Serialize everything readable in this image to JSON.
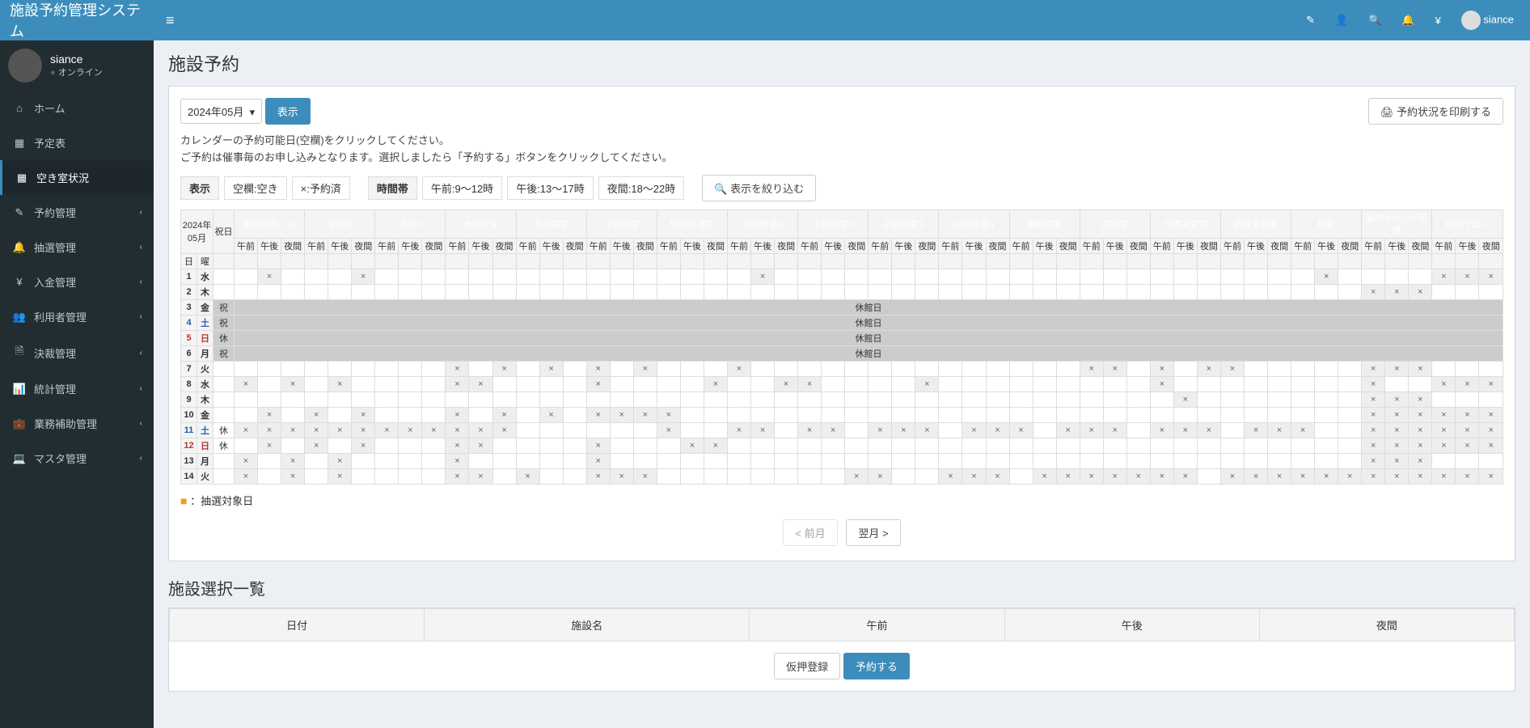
{
  "app_title": "施設予約管理システム",
  "user": {
    "name": "siance",
    "status": "オンライン"
  },
  "nav": [
    {
      "icon": "⌂",
      "label": "ホーム",
      "arrow": false,
      "active": false
    },
    {
      "icon": "▦",
      "label": "予定表",
      "arrow": false,
      "active": false
    },
    {
      "icon": "▦",
      "label": "空き室状況",
      "arrow": false,
      "active": true
    },
    {
      "icon": "✎",
      "label": "予約管理",
      "arrow": true,
      "active": false
    },
    {
      "icon": "🔔",
      "label": "抽選管理",
      "arrow": true,
      "active": false
    },
    {
      "icon": "¥",
      "label": "入金管理",
      "arrow": true,
      "active": false
    },
    {
      "icon": "👥",
      "label": "利用者管理",
      "arrow": true,
      "active": false
    },
    {
      "icon": "🗎",
      "label": "決裁管理",
      "arrow": true,
      "active": false
    },
    {
      "icon": "📊",
      "label": "統計管理",
      "arrow": true,
      "active": false
    },
    {
      "icon": "💼",
      "label": "業務補助管理",
      "arrow": true,
      "active": false
    },
    {
      "icon": "💻",
      "label": "マスタ管理",
      "arrow": true,
      "active": false
    }
  ],
  "page": {
    "title": "施設予約",
    "month_select": "2024年05月",
    "show_button": "表示",
    "print_button": "予約状況を印刷する",
    "instruction1": "カレンダーの予約可能日(空欄)をクリックしてください。",
    "instruction2": "ご予約は催事毎のお申し込みとなります。選択しましたら「予約する」ボタンをクリックしてください。",
    "legend": {
      "display_label": "表示",
      "empty": "空欄:空き",
      "x": "×:予約済",
      "time_label": "時間帯",
      "am": "午前:9～12時",
      "pm": "午後:13～17時",
      "night": "夜間:18～22時",
      "filter": "表示を絞り込む"
    },
    "header_date": "2024年05月",
    "header_day": "日",
    "header_dow": "曜",
    "header_holiday": "祝日",
    "rooms": [
      {
        "name": "多目的ホール",
        "cls": "r-pink"
      },
      {
        "name": "楽屋1",
        "cls": "r-pink"
      },
      {
        "name": "楽屋2",
        "cls": "r-pink"
      },
      {
        "name": "大研修室",
        "cls": "r-teal"
      },
      {
        "name": "大会議室",
        "cls": "r-teal"
      },
      {
        "name": "中研修室",
        "cls": "r-teal"
      },
      {
        "name": "特別会議室",
        "cls": "r-teal"
      },
      {
        "name": "小研修室1",
        "cls": "r-teal"
      },
      {
        "name": "小研修室2",
        "cls": "r-teal"
      },
      {
        "name": "小研修室3",
        "cls": "r-teal"
      },
      {
        "name": "小研修室4",
        "cls": "r-teal"
      },
      {
        "name": "講師控室",
        "cls": "r-teal"
      },
      {
        "name": "応接室",
        "cls": "r-teal"
      },
      {
        "name": "介護実習室",
        "cls": "r-orange"
      },
      {
        "name": "調理実習室",
        "cls": "r-orange"
      },
      {
        "name": "和室",
        "cls": "r-green"
      },
      {
        "name": "屋内イベント広場",
        "cls": "r-purple"
      },
      {
        "name": "県民サロン",
        "cls": "r-blue"
      }
    ],
    "slots": [
      "午前",
      "午後",
      "夜間"
    ],
    "days": [
      {
        "d": 1,
        "dow": "水",
        "dowcls": "",
        "hol": "",
        "type": "normal",
        "cells": "_x___x________________x_______________________x____xxx"
      },
      {
        "d": 2,
        "dow": "木",
        "dowcls": "",
        "hol": "",
        "type": "normal",
        "cells": "________________________________________________xxx___"
      },
      {
        "d": 3,
        "dow": "金",
        "dowcls": "",
        "hol": "祝",
        "type": "closed",
        "label": "休館日"
      },
      {
        "d": 4,
        "dow": "土",
        "dowcls": "sat",
        "hol": "祝",
        "type": "closed",
        "label": "休館日"
      },
      {
        "d": 5,
        "dow": "日",
        "dowcls": "sun",
        "hol": "休",
        "type": "closed",
        "label": "休館日"
      },
      {
        "d": 6,
        "dow": "月",
        "dowcls": "",
        "hol": "祝",
        "type": "closed",
        "label": "休館日"
      },
      {
        "d": 7,
        "dow": "火",
        "dowcls": "",
        "hol": "",
        "type": "normal",
        "cells": "_________x_x_x_x_x___x______________xx_x_xx_____xxx___"
      },
      {
        "d": 8,
        "dow": "水",
        "dowcls": "",
        "hol": "",
        "type": "normal",
        "cells": "x_x_x____xx____x____x__xx____x_________x________x__xxx"
      },
      {
        "d": 9,
        "dow": "木",
        "dowcls": "",
        "hol": "",
        "type": "normal",
        "cells": "________________________________________x_______xxx___"
      },
      {
        "d": 10,
        "dow": "金",
        "dowcls": "",
        "hol": "",
        "type": "normal",
        "cells": "_x_x_x___x_x_x_xxxx_____________________________xxxxxx"
      },
      {
        "d": 11,
        "dow": "土",
        "dowcls": "sat",
        "hol": "休",
        "type": "normal",
        "cells": "xxxxxxxxxxxx______x__xx_xx_xxx_xxx_xxx_xxx_xxx__xxxxxx"
      },
      {
        "d": 12,
        "dow": "日",
        "dowcls": "sun",
        "hol": "休",
        "type": "normal",
        "cells": "_x_x_x___xx____x___xx___________________________xxxxxx"
      },
      {
        "d": 13,
        "dow": "月",
        "dowcls": "",
        "hol": "",
        "type": "normal",
        "cells": "x_x_x____x_____x________________________________xxx___"
      },
      {
        "d": 14,
        "dow": "火",
        "dowcls": "",
        "hol": "",
        "type": "normal",
        "cells": "x_x_x____xx_x__xxx________xx__xxx_xxxxxxx_xxxxxxxxxxxx"
      }
    ],
    "lottery_legend": "：抽選対象日",
    "prev_month": "< 前月",
    "next_month": "翌月 >",
    "selection_title": "施設選択一覧",
    "sel_cols": {
      "date": "日付",
      "facility": "施設名",
      "am": "午前",
      "pm": "午後",
      "night": "夜間"
    },
    "temp_register": "仮押登録",
    "reserve": "予約する"
  }
}
